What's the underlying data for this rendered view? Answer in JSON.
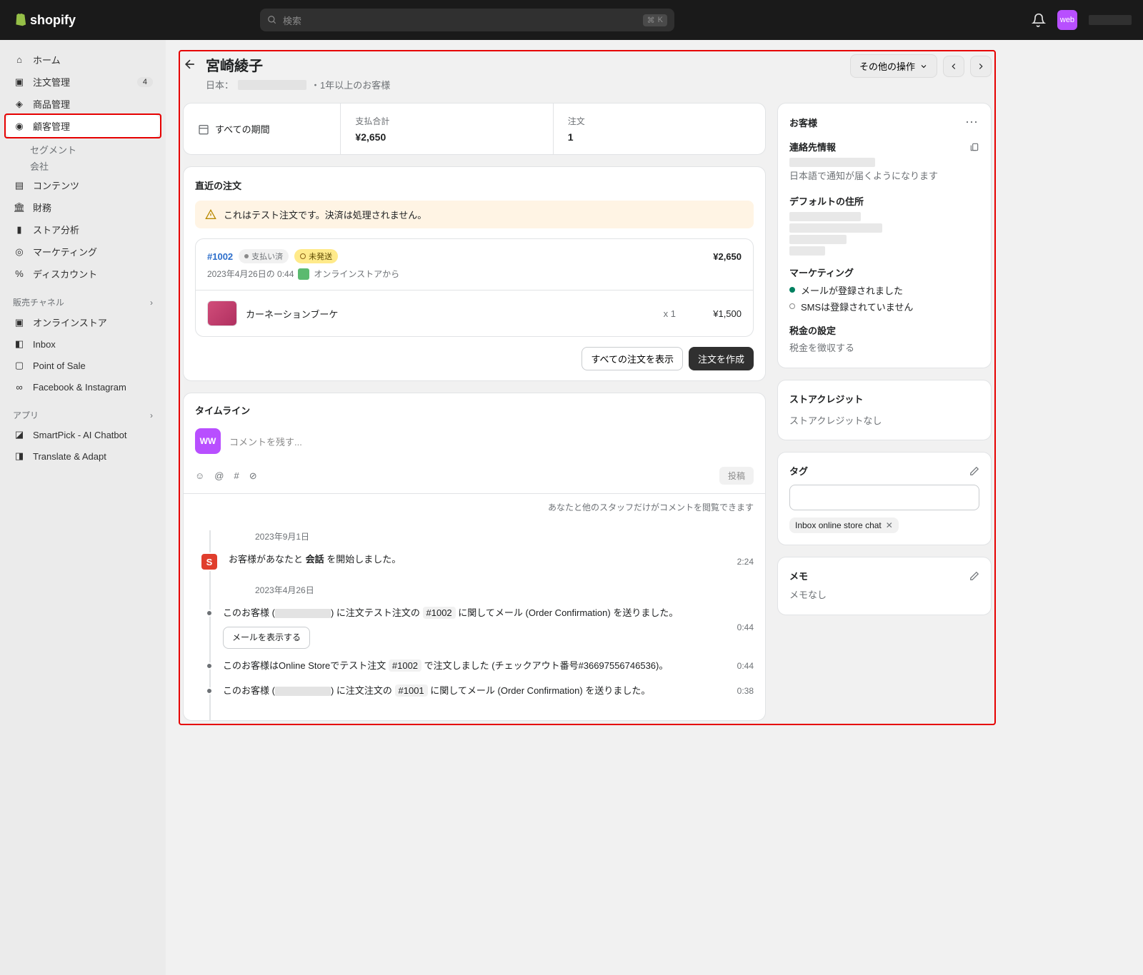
{
  "topbar": {
    "logo": "shopify",
    "search_placeholder": "検索",
    "kbd1": "⌘",
    "kbd2": "K",
    "avatar": "web"
  },
  "sidebar": {
    "home": "ホーム",
    "orders": "注文管理",
    "orders_badge": "4",
    "products": "商品管理",
    "customers": "顧客管理",
    "segments": "セグメント",
    "companies": "会社",
    "content": "コンテンツ",
    "finance": "財務",
    "analytics": "ストア分析",
    "marketing": "マーケティング",
    "discounts": "ディスカウント",
    "sales_channels_header": "販売チャネル",
    "online_store": "オンラインストア",
    "inbox": "Inbox",
    "pos": "Point of Sale",
    "fb_ig": "Facebook & Instagram",
    "apps_header": "アプリ",
    "smartpick": "SmartPick - AI Chatbot",
    "translate": "Translate & Adapt"
  },
  "page": {
    "title": "宮崎綾子",
    "country": "日本：",
    "duration": "・1年以上のお客様",
    "other_actions": "その他の操作"
  },
  "stats": {
    "period": "すべての期間",
    "payment_label": "支払合計",
    "payment_value": "¥2,650",
    "orders_label": "注文",
    "orders_value": "1"
  },
  "recent_orders": {
    "title": "直近の注文",
    "banner": "これはテスト注文です。決済は処理されません。",
    "order_id": "#1002",
    "paid": "支払い済",
    "unfulfilled": "未発送",
    "total": "¥2,650",
    "date": "2023年4月26日の 0:44",
    "channel": "オンラインストアから",
    "item_name": "カーネーションブーケ",
    "item_qty": "x 1",
    "item_price": "¥1,500",
    "view_all": "すべての注文を表示",
    "create": "注文を作成"
  },
  "timeline": {
    "title": "タイムライン",
    "avatar": "WW",
    "placeholder": "コメントを残す...",
    "post": "投稿",
    "note": "あなたと他のスタッフだけがコメントを閲覧できます",
    "date1": "2023年9月1日",
    "event1_pre": "お客様があなたと ",
    "event1_b": "会話",
    "event1_post": " を開始しました。",
    "event1_time": "2:24",
    "date2": "2023年4月26日",
    "event2_a": "このお客様 (",
    "event2_b": ") に注文テスト注文の ",
    "event2_ord": "#1002",
    "event2_c": " に関してメール (Order Confirmation) を送りました。",
    "event2_time": "0:44",
    "event2_btn": "メールを表示する",
    "event3_a": "このお客様はOnline Storeでテスト注文 ",
    "event3_ord": "#1002",
    "event3_b": " で注文しました (チェックアウト番号#36697556746536)。",
    "event3_time": "0:44",
    "event4_a": "このお客様 (",
    "event4_b": ") に注文注文の ",
    "event4_ord": "#1001",
    "event4_c": " に関してメール (Order Confirmation) を送りました。",
    "event4_time": "0:38"
  },
  "side": {
    "customer_title": "お客様",
    "contact_label": "連絡先情報",
    "contact_note": "日本語で通知が届くようになります",
    "address_label": "デフォルトの住所",
    "marketing_label": "マーケティング",
    "email_ok": "メールが登録されました",
    "sms_no": "SMSは登録されていません",
    "tax_label": "税金の設定",
    "tax_text": "税金を徴収する",
    "credit_title": "ストアクレジット",
    "credit_text": "ストアクレジットなし",
    "tags_title": "タグ",
    "tag1": "Inbox online store chat",
    "memo_title": "メモ",
    "memo_text": "メモなし"
  }
}
